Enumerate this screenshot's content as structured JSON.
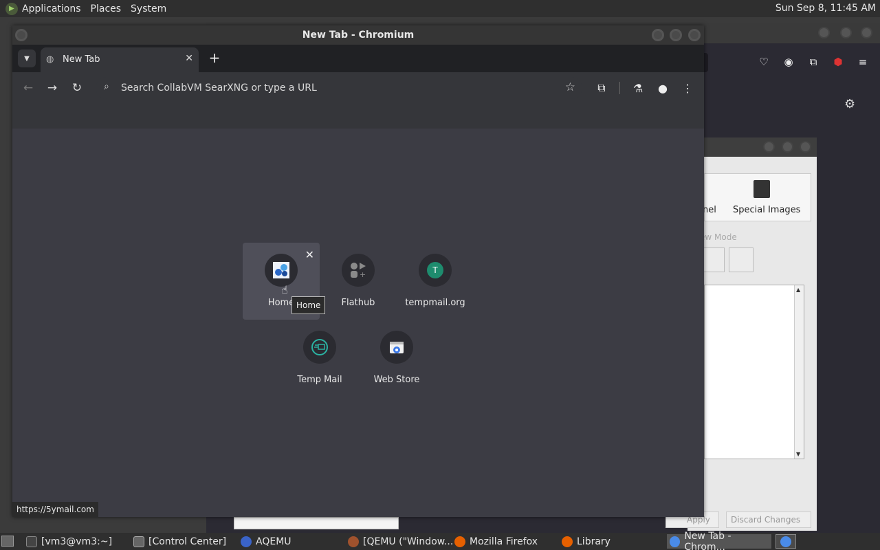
{
  "top_panel": {
    "menus": [
      "Applications",
      "Places",
      "System"
    ],
    "clock": "Sun Sep  8, 11:45 AM"
  },
  "chromium": {
    "window_title": "New Tab - Chromium",
    "tab_label": "New Tab",
    "omnibox_placeholder": "Search CollabVM SearXNG or type a URL",
    "shortcuts": [
      {
        "name": "Home",
        "icon": "home-site-icon"
      },
      {
        "name": "Flathub",
        "icon": "flathub-icon"
      },
      {
        "name": "tempmail.org",
        "icon": "letter-t-icon",
        "letter": "T"
      },
      {
        "name": "Temp Mail",
        "icon": "temp-mail-icon"
      },
      {
        "name": "Web Store",
        "icon": "web-store-icon"
      }
    ],
    "tooltip": "Home",
    "status_url": "https://5ymail.com"
  },
  "control_center": {
    "panel_labels": [
      "nel",
      "Special Images"
    ],
    "view_mode": "ew Mode",
    "buttons": [
      "Apply",
      "Discard Changes"
    ]
  },
  "taskbar": {
    "items": [
      {
        "label": "[vm3@vm3:~]",
        "icon": "terminal-icon"
      },
      {
        "label": "[Control Center]",
        "icon": "control-center-icon"
      },
      {
        "label": "AQEMU",
        "icon": "aqemu-icon"
      },
      {
        "label": "[QEMU (\"Window...",
        "icon": "qemu-icon"
      },
      {
        "label": "Mozilla Firefox",
        "icon": "firefox-icon"
      },
      {
        "label": "Library",
        "icon": "firefox-icon"
      },
      {
        "label": "New Tab - Chrom...",
        "icon": "chromium-icon"
      }
    ]
  }
}
